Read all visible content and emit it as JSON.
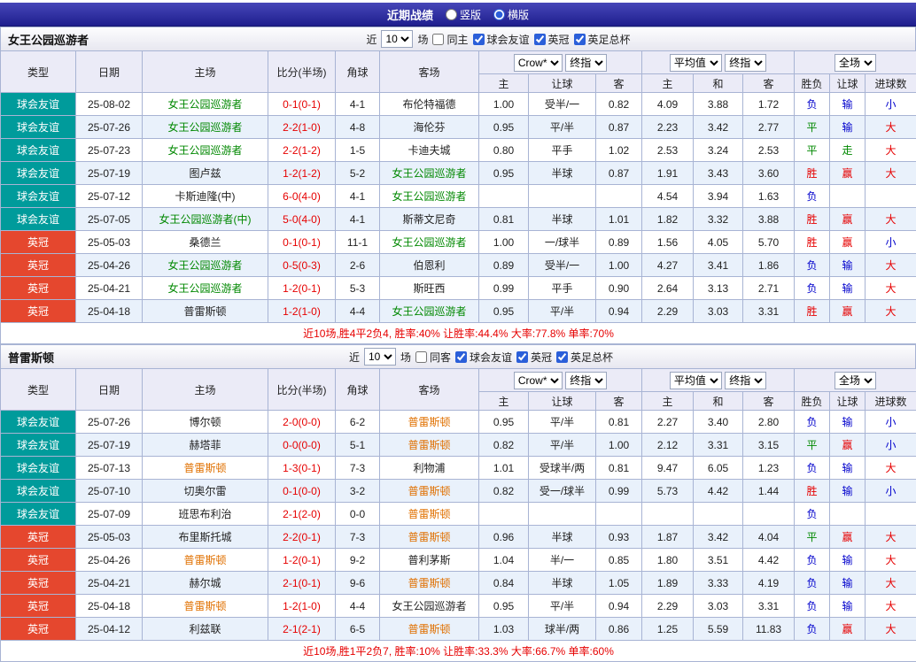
{
  "title_bar": {
    "title": "近期战绩",
    "layout_options": [
      {
        "label": "竖版",
        "selected": false
      },
      {
        "label": "横版",
        "selected": true
      }
    ]
  },
  "controls": {
    "near_label": "近",
    "count_value": "10",
    "matches_label": "场"
  },
  "table_header": {
    "type": "类型",
    "date": "日期",
    "home": "主场",
    "score": "比分(半场)",
    "corners": "角球",
    "away": "客场",
    "odds_provider": "Crow*",
    "odds_stage": "终指",
    "avg_label": "平均值",
    "avg_stage": "终指",
    "scope": "全场",
    "odds_home": "主",
    "odds_handicap": "让球",
    "odds_away": "客",
    "avg_home": "主",
    "avg_draw": "和",
    "avg_away": "客",
    "result_wdl": "胜负",
    "result_handicap": "让球",
    "result_goals": "进球数"
  },
  "sections": [
    {
      "team": "女王公园巡游者",
      "team_color": "#008800",
      "same_label": "同主",
      "same_checked": false,
      "filters": [
        {
          "label": "球会友谊",
          "checked": true
        },
        {
          "label": "英冠",
          "checked": true
        },
        {
          "label": "英足总杯",
          "checked": true
        }
      ],
      "rows": [
        {
          "league": "球会友谊",
          "date": "25-08-02",
          "home": "女王公园巡游者",
          "home_is_subject": true,
          "score": "0-1(0-1)",
          "corners": "4-1",
          "away": "布伦特福德",
          "away_is_subject": false,
          "odds": [
            "1.00",
            "受半/一",
            "0.82"
          ],
          "avg": [
            "4.09",
            "3.88",
            "1.72"
          ],
          "results": [
            "负",
            "输",
            "小"
          ]
        },
        {
          "league": "球会友谊",
          "date": "25-07-26",
          "home": "女王公园巡游者",
          "home_is_subject": true,
          "score": "2-2(1-0)",
          "corners": "4-8",
          "away": "海伦芬",
          "away_is_subject": false,
          "odds": [
            "0.95",
            "平/半",
            "0.87"
          ],
          "avg": [
            "2.23",
            "3.42",
            "2.77"
          ],
          "results": [
            "平",
            "输",
            "大"
          ]
        },
        {
          "league": "球会友谊",
          "date": "25-07-23",
          "home": "女王公园巡游者",
          "home_is_subject": true,
          "score": "2-2(1-2)",
          "corners": "1-5",
          "away": "卡迪夫城",
          "away_is_subject": false,
          "odds": [
            "0.80",
            "平手",
            "1.02"
          ],
          "avg": [
            "2.53",
            "3.24",
            "2.53"
          ],
          "results": [
            "平",
            "走",
            "大"
          ]
        },
        {
          "league": "球会友谊",
          "date": "25-07-19",
          "home": "图卢兹",
          "home_is_subject": false,
          "score": "1-2(1-2)",
          "corners": "5-2",
          "away": "女王公园巡游者",
          "away_is_subject": true,
          "odds": [
            "0.95",
            "半球",
            "0.87"
          ],
          "avg": [
            "1.91",
            "3.43",
            "3.60"
          ],
          "results": [
            "胜",
            "赢",
            "大"
          ]
        },
        {
          "league": "球会友谊",
          "date": "25-07-12",
          "home": "卡斯迪隆(中)",
          "home_is_subject": false,
          "score": "6-0(4-0)",
          "corners": "4-1",
          "away": "女王公园巡游者",
          "away_is_subject": true,
          "odds": [
            "",
            "",
            ""
          ],
          "avg": [
            "4.54",
            "3.94",
            "1.63"
          ],
          "results": [
            "负",
            "",
            ""
          ]
        },
        {
          "league": "球会友谊",
          "date": "25-07-05",
          "home": "女王公园巡游者(中)",
          "home_is_subject": true,
          "score": "5-0(4-0)",
          "corners": "4-1",
          "away": "斯蒂文尼奇",
          "away_is_subject": false,
          "odds": [
            "0.81",
            "半球",
            "1.01"
          ],
          "avg": [
            "1.82",
            "3.32",
            "3.88"
          ],
          "results": [
            "胜",
            "赢",
            "大"
          ]
        },
        {
          "league": "英冠",
          "date": "25-05-03",
          "home": "桑德兰",
          "home_is_subject": false,
          "score": "0-1(0-1)",
          "corners": "11-1",
          "away": "女王公园巡游者",
          "away_is_subject": true,
          "odds": [
            "1.00",
            "一/球半",
            "0.89"
          ],
          "avg": [
            "1.56",
            "4.05",
            "5.70"
          ],
          "results": [
            "胜",
            "赢",
            "小"
          ]
        },
        {
          "league": "英冠",
          "date": "25-04-26",
          "home": "女王公园巡游者",
          "home_is_subject": true,
          "score": "0-5(0-3)",
          "corners": "2-6",
          "away": "伯恩利",
          "away_is_subject": false,
          "odds": [
            "0.89",
            "受半/一",
            "1.00"
          ],
          "avg": [
            "4.27",
            "3.41",
            "1.86"
          ],
          "results": [
            "负",
            "输",
            "大"
          ]
        },
        {
          "league": "英冠",
          "date": "25-04-21",
          "home": "女王公园巡游者",
          "home_is_subject": true,
          "score": "1-2(0-1)",
          "corners": "5-3",
          "away": "斯旺西",
          "away_is_subject": false,
          "odds": [
            "0.99",
            "平手",
            "0.90"
          ],
          "avg": [
            "2.64",
            "3.13",
            "2.71"
          ],
          "results": [
            "负",
            "输",
            "大"
          ]
        },
        {
          "league": "英冠",
          "date": "25-04-18",
          "home": "普雷斯顿",
          "home_is_subject": false,
          "score": "1-2(1-0)",
          "corners": "4-4",
          "away": "女王公园巡游者",
          "away_is_subject": true,
          "odds": [
            "0.95",
            "平/半",
            "0.94"
          ],
          "avg": [
            "2.29",
            "3.03",
            "3.31"
          ],
          "results": [
            "胜",
            "赢",
            "大"
          ]
        }
      ],
      "summary": "近10场,胜4平2负4, 胜率:40% 让胜率:44.4% 大率:77.8% 单率:70%"
    },
    {
      "team": "普雷斯顿",
      "team_color": "#e07000",
      "same_label": "同客",
      "same_checked": false,
      "filters": [
        {
          "label": "球会友谊",
          "checked": true
        },
        {
          "label": "英冠",
          "checked": true
        },
        {
          "label": "英足总杯",
          "checked": true
        }
      ],
      "rows": [
        {
          "league": "球会友谊",
          "date": "25-07-26",
          "home": "博尔顿",
          "home_is_subject": false,
          "score": "2-0(0-0)",
          "corners": "6-2",
          "away": "普雷斯顿",
          "away_is_subject": true,
          "odds": [
            "0.95",
            "平/半",
            "0.81"
          ],
          "avg": [
            "2.27",
            "3.40",
            "2.80"
          ],
          "results": [
            "负",
            "输",
            "小"
          ]
        },
        {
          "league": "球会友谊",
          "date": "25-07-19",
          "home": "赫塔菲",
          "home_is_subject": false,
          "score": "0-0(0-0)",
          "corners": "5-1",
          "away": "普雷斯顿",
          "away_is_subject": true,
          "odds": [
            "0.82",
            "平/半",
            "1.00"
          ],
          "avg": [
            "2.12",
            "3.31",
            "3.15"
          ],
          "results": [
            "平",
            "赢",
            "小"
          ]
        },
        {
          "league": "球会友谊",
          "date": "25-07-13",
          "home": "普雷斯顿",
          "home_is_subject": true,
          "score": "1-3(0-1)",
          "corners": "7-3",
          "away": "利物浦",
          "away_is_subject": false,
          "odds": [
            "1.01",
            "受球半/两",
            "0.81"
          ],
          "avg": [
            "9.47",
            "6.05",
            "1.23"
          ],
          "results": [
            "负",
            "输",
            "大"
          ]
        },
        {
          "league": "球会友谊",
          "date": "25-07-10",
          "home": "切奥尔雷",
          "home_is_subject": false,
          "score": "0-1(0-0)",
          "corners": "3-2",
          "away": "普雷斯顿",
          "away_is_subject": true,
          "odds": [
            "0.82",
            "受一/球半",
            "0.99"
          ],
          "avg": [
            "5.73",
            "4.42",
            "1.44"
          ],
          "results": [
            "胜",
            "输",
            "小"
          ]
        },
        {
          "league": "球会友谊",
          "date": "25-07-09",
          "home": "班思布利治",
          "home_is_subject": false,
          "score": "2-1(2-0)",
          "corners": "0-0",
          "away": "普雷斯顿",
          "away_is_subject": true,
          "odds": [
            "",
            "",
            ""
          ],
          "avg": [
            "",
            "",
            ""
          ],
          "results": [
            "负",
            "",
            ""
          ]
        },
        {
          "league": "英冠",
          "date": "25-05-03",
          "home": "布里斯托城",
          "home_is_subject": false,
          "score": "2-2(0-1)",
          "corners": "7-3",
          "away": "普雷斯顿",
          "away_is_subject": true,
          "odds": [
            "0.96",
            "半球",
            "0.93"
          ],
          "avg": [
            "1.87",
            "3.42",
            "4.04"
          ],
          "results": [
            "平",
            "赢",
            "大"
          ]
        },
        {
          "league": "英冠",
          "date": "25-04-26",
          "home": "普雷斯顿",
          "home_is_subject": true,
          "score": "1-2(0-1)",
          "corners": "9-2",
          "away": "普利茅斯",
          "away_is_subject": false,
          "odds": [
            "1.04",
            "半/一",
            "0.85"
          ],
          "avg": [
            "1.80",
            "3.51",
            "4.42"
          ],
          "results": [
            "负",
            "输",
            "大"
          ]
        },
        {
          "league": "英冠",
          "date": "25-04-21",
          "home": "赫尔城",
          "home_is_subject": false,
          "score": "2-1(0-1)",
          "corners": "9-6",
          "away": "普雷斯顿",
          "away_is_subject": true,
          "odds": [
            "0.84",
            "半球",
            "1.05"
          ],
          "avg": [
            "1.89",
            "3.33",
            "4.19"
          ],
          "results": [
            "负",
            "输",
            "大"
          ]
        },
        {
          "league": "英冠",
          "date": "25-04-18",
          "home": "普雷斯顿",
          "home_is_subject": true,
          "score": "1-2(1-0)",
          "corners": "4-4",
          "away": "女王公园巡游者",
          "away_is_subject": false,
          "odds": [
            "0.95",
            "平/半",
            "0.94"
          ],
          "avg": [
            "2.29",
            "3.03",
            "3.31"
          ],
          "results": [
            "负",
            "输",
            "大"
          ]
        },
        {
          "league": "英冠",
          "date": "25-04-12",
          "home": "利兹联",
          "home_is_subject": false,
          "score": "2-1(2-1)",
          "corners": "6-5",
          "away": "普雷斯顿",
          "away_is_subject": true,
          "odds": [
            "1.03",
            "球半/两",
            "0.86"
          ],
          "avg": [
            "1.25",
            "5.59",
            "11.83"
          ],
          "results": [
            "负",
            "赢",
            "大"
          ]
        }
      ],
      "summary": "近10场,胜1平2负7, 胜率:10% 让胜率:33.3% 大率:66.7% 单率:60%"
    }
  ],
  "colors": {
    "title_bar_bg": "#2b2b9e",
    "friendly_type_bg": "#009b9b",
    "championship_type_bg": "#e5472e",
    "win_text": "#e60000",
    "draw_text": "#008800",
    "lose_text": "#0000cc",
    "big_text": "#e60000",
    "small_text": "#0000cc",
    "score_text": "#e60000",
    "summary_text": "#e60000",
    "qpr_team_text": "#008800",
    "preston_team_text": "#e07000"
  }
}
